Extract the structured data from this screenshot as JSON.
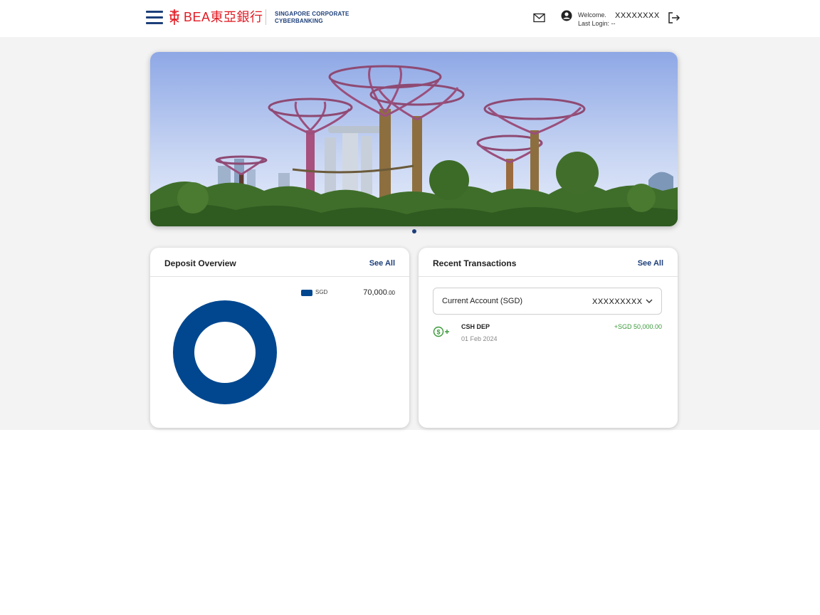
{
  "header": {
    "brand_name": "BEA東亞銀行",
    "brand_subtitle_line1": "SINGAPORE CORPORATE",
    "brand_subtitle_line2": "CYBERBANKING",
    "welcome_label": "Welcome.",
    "last_login_label": "Last Login: --",
    "username": "XXXXXXXX",
    "icons": [
      "hamburger-menu-icon",
      "mail-icon",
      "user-icon",
      "logout-icon"
    ]
  },
  "banner": {
    "slides": 1,
    "active_slide": 1
  },
  "deposit_overview": {
    "title": "Deposit Overview",
    "see_all": "See All",
    "legend": [
      {
        "currency": "SGD",
        "amount_main": "70,000",
        "amount_decimals": ".00",
        "color": "#00478f"
      }
    ]
  },
  "recent_transactions": {
    "title": "Recent Transactions",
    "see_all": "See All",
    "account_select": {
      "label": "Current Account (SGD)",
      "account_number": "XXXXXXXXX"
    },
    "items": [
      {
        "description": "CSH DEP",
        "date": "01 Feb 2024",
        "amount": "+SGD 50,000.00",
        "icon": "cash-deposit-icon"
      }
    ]
  },
  "chart_data": {
    "type": "pie",
    "categories": [
      "SGD"
    ],
    "values": [
      70000
    ],
    "donut": true
  },
  "colors": {
    "brand_red": "#e21b23",
    "brand_navy": "#1d3f7a",
    "chart_blue": "#00478f",
    "credit_green": "#3a9a3a"
  }
}
